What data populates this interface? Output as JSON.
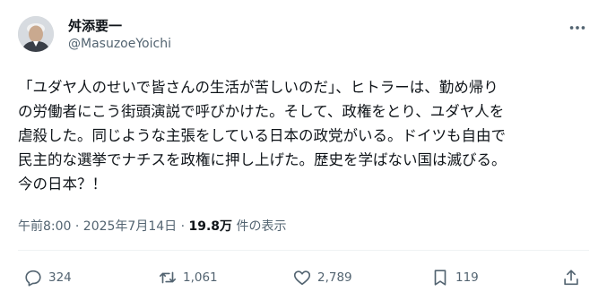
{
  "post": {
    "author_name": "舛添要一",
    "author_handle": "@MasuzoeYoichi",
    "text": "「ユダヤ人のせいで皆さんの生活が苦しいのだ」、ヒトラーは、勤め帰り\nの労働者にこう街頭演説で呼びかけた。そして、政権をとり、ユダヤ人を\n虐殺した。同じような主張をしている日本の政党がいる。ドイツも自由で\n民主的な選挙でナチスを政権に押し上げた。歴史を学ばない国は滅びる。\n今の日本？！",
    "timestamp": "午前8:00 · 2025年7月14日 · ",
    "views_count": "19.8万",
    "views_label": " 件の表示"
  },
  "actions": {
    "reply_count": "324",
    "repost_count": "1,061",
    "like_count": "2,789",
    "bookmark_count": "119"
  },
  "icons": {
    "more": "more-options-icon",
    "reply": "reply-icon",
    "repost": "repost-icon",
    "like": "heart-icon",
    "bookmark": "bookmark-icon",
    "share": "share-icon"
  },
  "colors": {
    "text_primary": "#0f1419",
    "text_secondary": "#536471",
    "divider": "#eff3f4"
  }
}
